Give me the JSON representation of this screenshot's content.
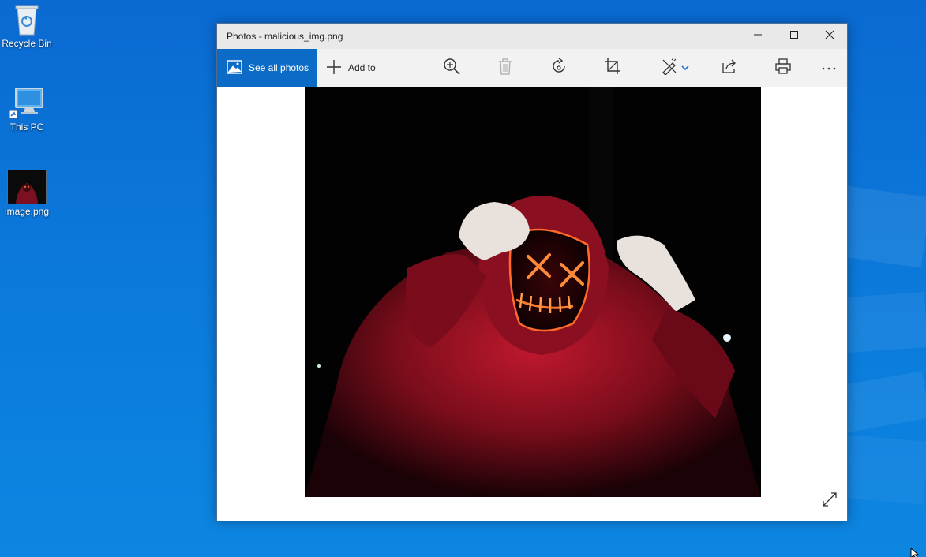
{
  "desktop": {
    "icons": [
      {
        "label": "Recycle Bin"
      },
      {
        "label": "This PC"
      },
      {
        "label": "image.png"
      }
    ]
  },
  "window": {
    "title": "Photos - malicious_img.png",
    "controls": [
      "minimize-icon",
      "maximize-icon",
      "close-icon"
    ],
    "toolbar": {
      "see_all": "See all photos",
      "add_to": "Add to",
      "tools": [
        "zoom-in-icon",
        "delete-icon",
        "rotate-icon",
        "crop-icon",
        "edit-icon",
        "share-icon",
        "print-icon",
        "more-icon"
      ]
    }
  },
  "colors": {
    "accent": "#0c6bc6",
    "desktop": "#0a78d7",
    "titlebar": "#e9e9e9",
    "toolbar": "#f2f2f2"
  }
}
